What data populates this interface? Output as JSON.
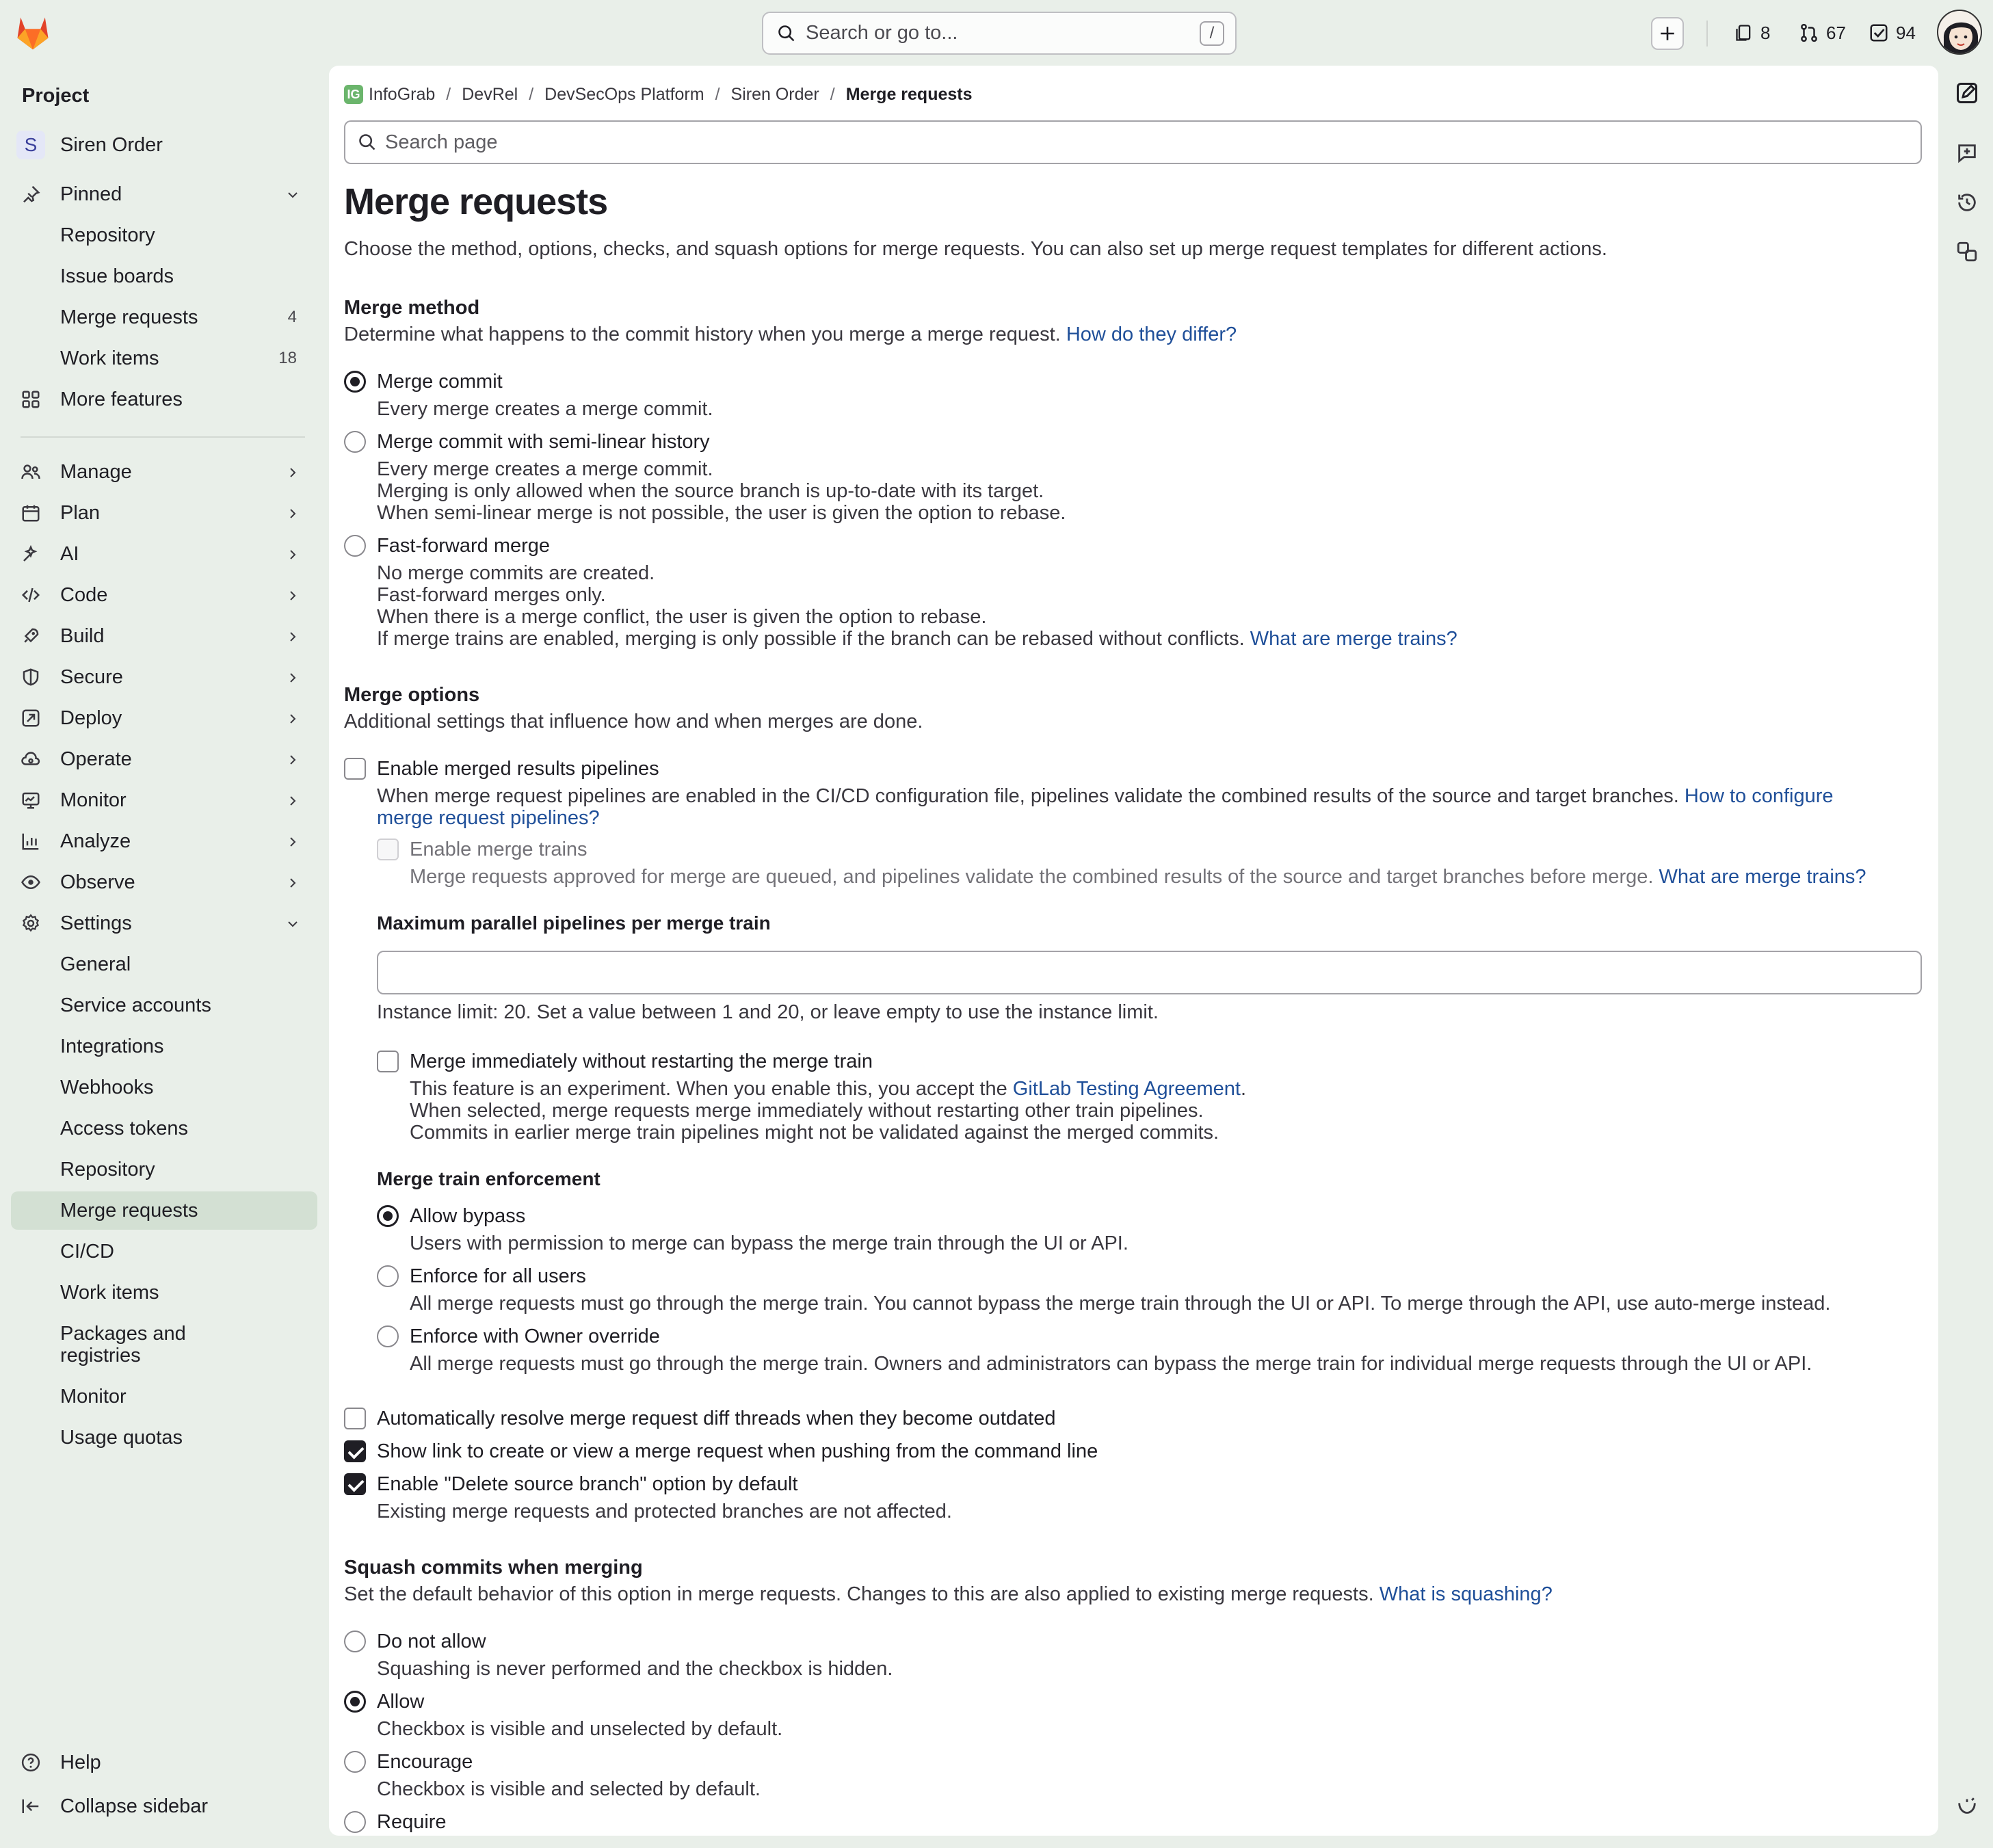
{
  "topbar": {
    "search_placeholder": "Search or go to...",
    "search_shortcut": "/",
    "issues_count": "8",
    "merge_requests_count": "67",
    "todos_count": "94"
  },
  "sidebar": {
    "section_title": "Project",
    "project_initial": "S",
    "project_name": "Siren Order",
    "pinned": "Pinned",
    "pinned_items": [
      {
        "label": "Repository",
        "badge": ""
      },
      {
        "label": "Issue boards",
        "badge": ""
      },
      {
        "label": "Merge requests",
        "badge": "4"
      },
      {
        "label": "Work items",
        "badge": "18"
      }
    ],
    "more_features": "More features",
    "groups": [
      "Manage",
      "Plan",
      "AI",
      "Code",
      "Build",
      "Secure",
      "Deploy",
      "Operate",
      "Monitor",
      "Analyze",
      "Observe",
      "Settings"
    ],
    "settings_items": [
      "General",
      "Service accounts",
      "Integrations",
      "Webhooks",
      "Access tokens",
      "Repository",
      "Merge requests",
      "CI/CD",
      "Work items",
      "Packages and registries",
      "Monitor",
      "Usage quotas"
    ],
    "help": "Help",
    "collapse": "Collapse sidebar"
  },
  "breadcrumb": {
    "icon_text": "IG",
    "items": [
      "InfoGrab",
      "DevRel",
      "DevSecOps Platform",
      "Siren Order",
      "Merge requests"
    ]
  },
  "page_search_placeholder": "Search page",
  "page": {
    "title": "Merge requests",
    "description": "Choose the method, options, checks, and squash options for merge requests. You can also set up merge request templates for different actions."
  },
  "merge_method": {
    "heading": "Merge method",
    "description": "Determine what happens to the commit history when you merge a merge request.",
    "help_link": "How do they differ?",
    "options": [
      {
        "label": "Merge commit",
        "lines": [
          "Every merge creates a merge commit."
        ],
        "selected": true
      },
      {
        "label": "Merge commit with semi-linear history",
        "lines": [
          "Every merge creates a merge commit.",
          "Merging is only allowed when the source branch is up-to-date with its target.",
          "When semi-linear merge is not possible, the user is given the option to rebase."
        ],
        "selected": false
      },
      {
        "label": "Fast-forward merge",
        "lines": [
          "No merge commits are created.",
          "Fast-forward merges only.",
          "When there is a merge conflict, the user is given the option to rebase.",
          "If merge trains are enabled, merging is only possible if the branch can be rebased without conflicts."
        ],
        "link": "What are merge trains?",
        "selected": false
      }
    ]
  },
  "merge_options": {
    "heading": "Merge options",
    "description": "Additional settings that influence how and when merges are done.",
    "merged_results": {
      "label": "Enable merged results pipelines",
      "help": "When merge request pipelines are enabled in the CI/CD configuration file, pipelines validate the combined results of the source and target branches.",
      "link": "How to configure merge request pipelines?",
      "link_line1": "How to configure",
      "link_line2": "merge request pipelines?",
      "checked": false
    },
    "merge_trains": {
      "label": "Enable merge trains",
      "help": "Merge requests approved for merge are queued, and pipelines validate the combined results of the source and target branches before merge.",
      "link": "What are merge trains?",
      "checked": false
    },
    "max_parallel": {
      "label": "Maximum parallel pipelines per merge train",
      "value": "",
      "help": "Instance limit: 20. Set a value between 1 and 20, or leave empty to use the instance limit."
    },
    "merge_immediately": {
      "label": "Merge immediately without restarting the merge train",
      "help_prefix": "This feature is an experiment. When you enable this, you accept the",
      "help_link": "GitLab Testing Agreement",
      "help_suffix": ".",
      "lines": [
        "When selected, merge requests merge immediately without restarting other train pipelines.",
        "Commits in earlier merge train pipelines might not be validated against the merged commits."
      ],
      "checked": false
    },
    "enforcement": {
      "heading": "Merge train enforcement",
      "options": [
        {
          "label": "Allow bypass",
          "help": "Users with permission to merge can bypass the merge train through the UI or API.",
          "selected": true
        },
        {
          "label": "Enforce for all users",
          "help": "All merge requests must go through the merge train. You cannot bypass the merge train through the UI or API. To merge through the API, use auto-merge instead.",
          "selected": false
        },
        {
          "label": "Enforce with Owner override",
          "help": "All merge requests must go through the merge train. Owners and administrators can bypass the merge train for individual merge requests through the UI or API.",
          "selected": false
        }
      ]
    },
    "auto_resolve": {
      "label": "Automatically resolve merge request diff threads when they become outdated",
      "checked": false
    },
    "show_link": {
      "label": "Show link to create or view a merge request when pushing from the command line",
      "checked": true
    },
    "delete_branch": {
      "label": "Enable \"Delete source branch\" option by default",
      "help": "Existing merge requests and protected branches are not affected.",
      "checked": true
    }
  },
  "squash": {
    "heading": "Squash commits when merging",
    "description": "Set the default behavior of this option in merge requests. Changes to this are also applied to existing merge requests.",
    "link": "What is squashing?",
    "options": [
      {
        "label": "Do not allow",
        "help": "Squashing is never performed and the checkbox is hidden.",
        "selected": false
      },
      {
        "label": "Allow",
        "help": "Checkbox is visible and unselected by default.",
        "selected": true
      },
      {
        "label": "Encourage",
        "help": "Checkbox is visible and selected by default.",
        "selected": false
      },
      {
        "label": "Require",
        "help": "",
        "selected": false
      }
    ]
  },
  "colors": {
    "accent_link": "#1f4f99",
    "sidebar_bg": "#e9efe9",
    "active_item": "#d3e0d3",
    "brand": "#e24329"
  }
}
